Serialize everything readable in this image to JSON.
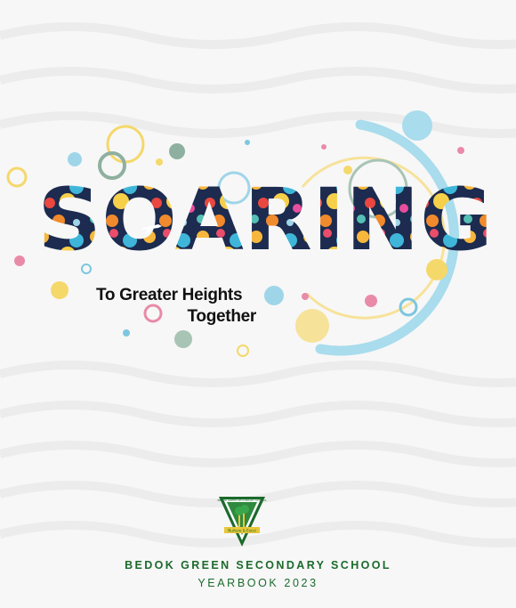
{
  "cover": {
    "title": "SOARING",
    "subtitle_line1": "To Greater Heights",
    "subtitle_line2": "Together",
    "school_name": "BEDOK GREEN SECONDARY SCHOOL",
    "yearbook_label": "YEARBOOK 2023",
    "crest_text_top": "BEDOK GREEN SECONDARY SCHOOL",
    "crest_motto": "Nurture & Excel"
  },
  "colors": {
    "background": "#f7f7f7",
    "title_navy": "#1c2b4f",
    "accent_blue": "#7cc7e0",
    "accent_yellow": "#f5d86a",
    "accent_pink": "#e98aa8",
    "accent_sage": "#8fb0a0",
    "school_green": "#1b6a2c"
  },
  "icons": [
    "airplane-icon",
    "school-crest-icon"
  ]
}
